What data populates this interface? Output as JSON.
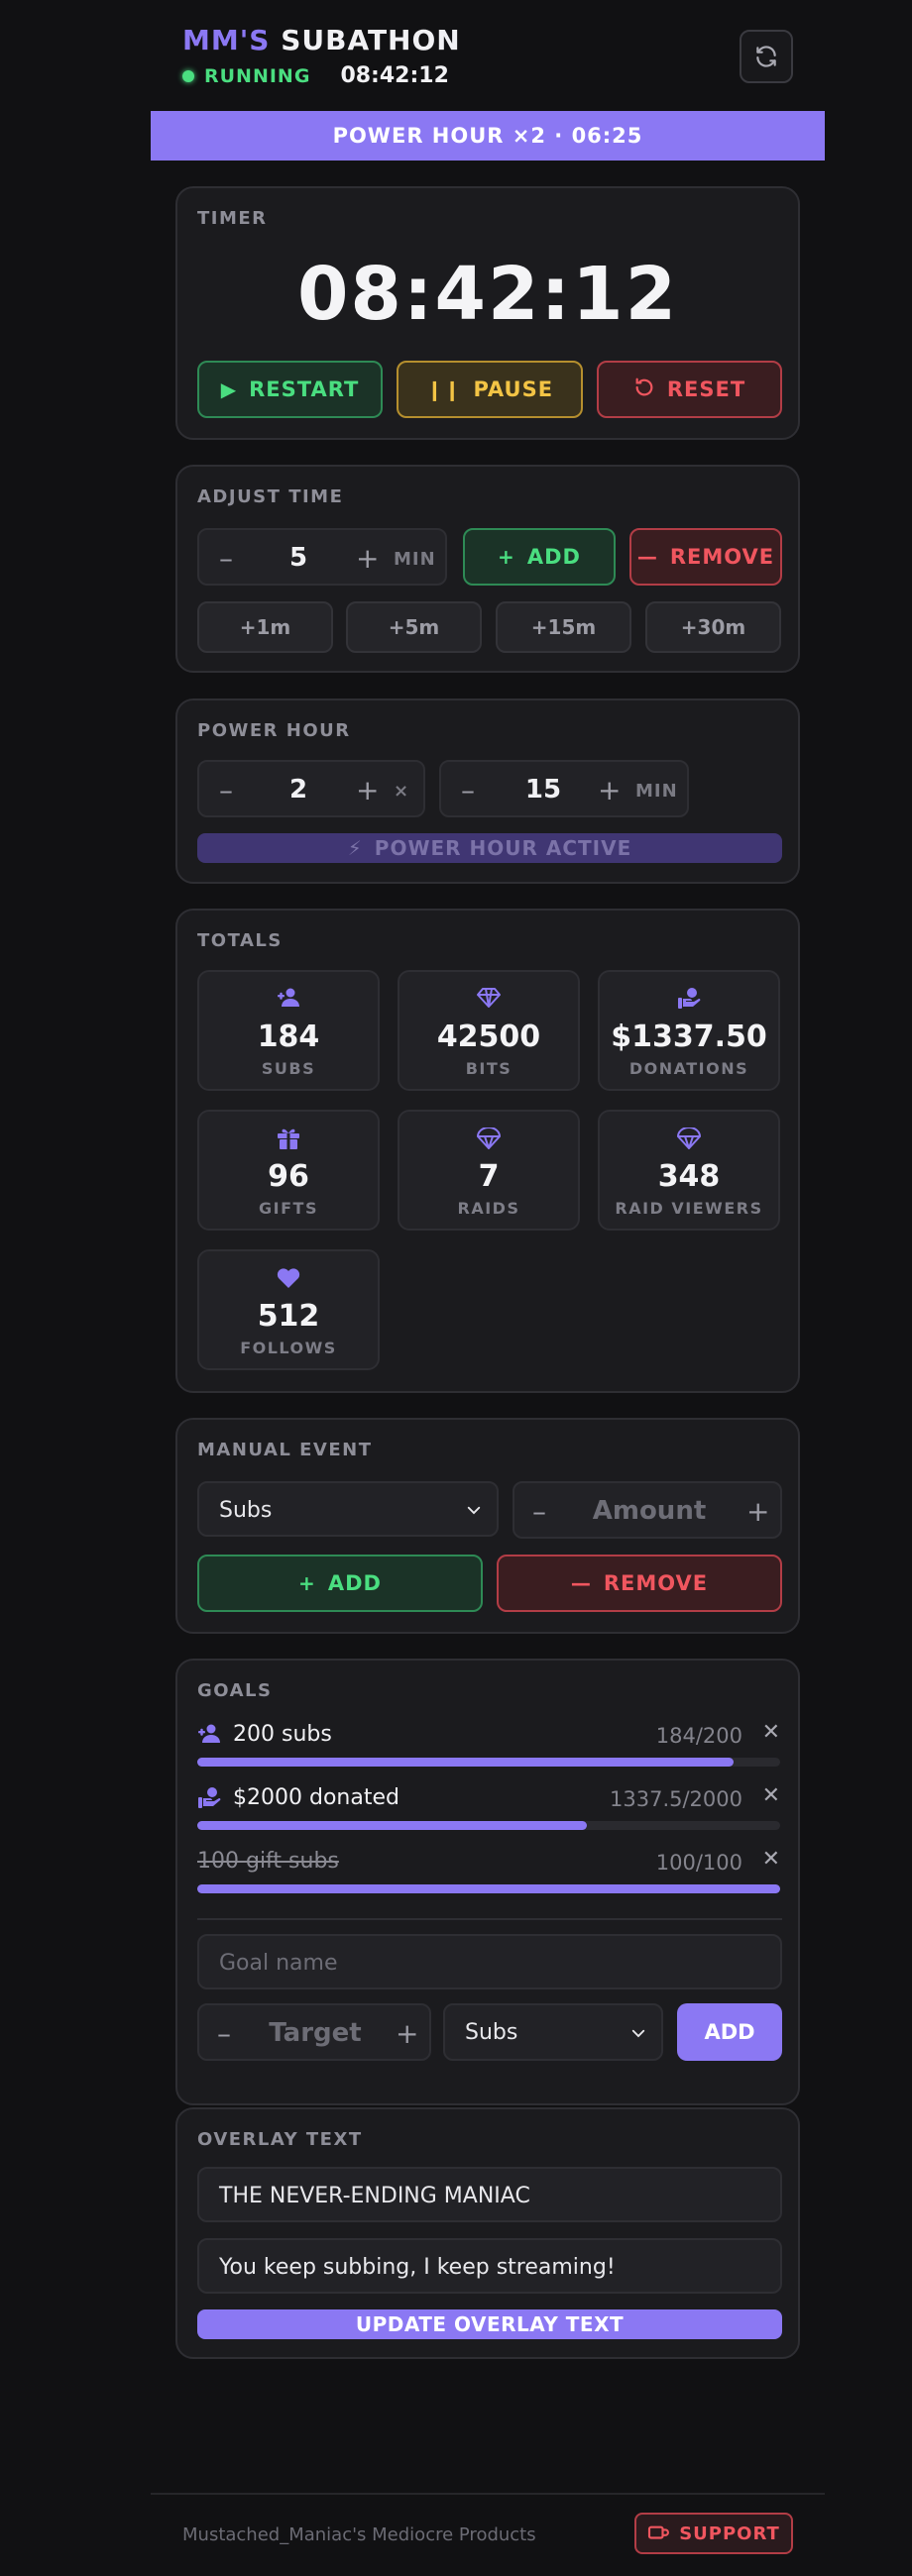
{
  "header": {
    "brand_accent": "MM'S",
    "brand_rest": "SUBATHON",
    "status": "RUNNING",
    "time": "08:42:12"
  },
  "banner": "POWER HOUR ×2 · 06:25",
  "timer": {
    "title": "TIMER",
    "time": "08:42:12",
    "restart": "RESTART",
    "pause": "PAUSE",
    "reset": "RESET"
  },
  "adjust": {
    "title": "ADJUST TIME",
    "minus": "–",
    "plus": "+",
    "value": "5",
    "unit": "MIN",
    "add": "ADD",
    "remove": "REMOVE",
    "quick": [
      "+1m",
      "+5m",
      "+15m",
      "+30m"
    ]
  },
  "power_hour": {
    "title": "POWER HOUR",
    "multiplier": "2",
    "multiplier_unit": "×",
    "minutes": "15",
    "minutes_unit": "MIN",
    "active_label": "POWER HOUR ACTIVE"
  },
  "totals": {
    "title": "TOTALS",
    "tiles": [
      {
        "value": "184",
        "label": "SUBS",
        "icon": "user-plus-icon"
      },
      {
        "value": "42500",
        "label": "BITS",
        "icon": "diamond-icon"
      },
      {
        "value": "$1337.50",
        "label": "DONATIONS",
        "icon": "hand-coin-icon"
      },
      {
        "value": "96",
        "label": "GIFTS",
        "icon": "gift-icon"
      },
      {
        "value": "7",
        "label": "RAIDS",
        "icon": "parachute-icon"
      },
      {
        "value": "348",
        "label": "RAID VIEWERS",
        "icon": "parachute-icon"
      },
      {
        "value": "512",
        "label": "FOLLOWS",
        "icon": "heart-icon"
      }
    ]
  },
  "manual": {
    "title": "MANUAL EVENT",
    "select_value": "Subs",
    "amount_placeholder": "Amount",
    "add": "ADD",
    "remove": "REMOVE"
  },
  "goals": {
    "title": "GOALS",
    "items": [
      {
        "name": "200 subs",
        "progress": "184/200",
        "fraction": 0.92,
        "icon": "user-plus-icon",
        "done": false
      },
      {
        "name": "$2000 donated",
        "progress": "1337.5/2000",
        "fraction": 0.669,
        "icon": "hand-coin-icon",
        "done": false
      },
      {
        "name": "100 gift subs",
        "progress": "100/100",
        "fraction": 1.0,
        "icon": "",
        "done": true
      }
    ],
    "remove_glyph": "✕",
    "name_placeholder": "Goal name",
    "target_placeholder": "Target",
    "type_value": "Subs",
    "add": "ADD"
  },
  "overlay": {
    "title": "OVERLAY TEXT",
    "line1": "THE NEVER-ENDING MANIAC",
    "line2": "You keep subbing, I keep streaming!",
    "update": "UPDATE OVERLAY TEXT"
  },
  "footer": {
    "credit": "Mustached_Maniac's Mediocre Products",
    "support": "SUPPORT"
  },
  "colors": {
    "accent": "#8b78f3",
    "running": "#4ade80",
    "danger": "#f0565f",
    "warning": "#f3c445"
  }
}
